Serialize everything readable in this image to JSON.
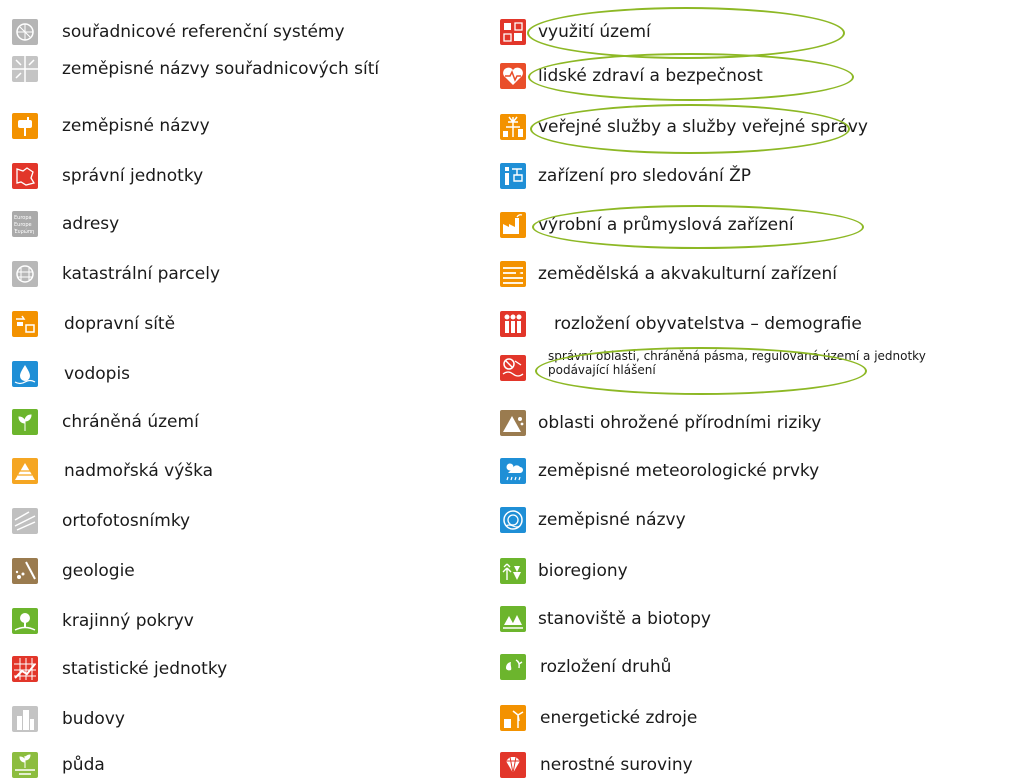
{
  "left_column": [
    {
      "label": "souřadnicové referenční systémy",
      "icon": "globe-grid-icon",
      "color": "#b5b5b5"
    },
    {
      "label": "zeměpisné názvy souřadnicových sítí",
      "icon": "grid-arrows-icon",
      "color": "#c4c4c4"
    },
    {
      "label": "zeměpisné názvy",
      "icon": "mailbox-icon",
      "color": "#f39200"
    },
    {
      "label": "správní jednotky",
      "icon": "map-regions-icon",
      "color": "#e2362a"
    },
    {
      "label": "adresy",
      "icon": "address-text-icon",
      "color": "#aaaaaa",
      "icon_text": [
        "Europa",
        "Europe",
        "Έυρώπη"
      ]
    },
    {
      "label": "katastrální parcely",
      "icon": "parcel-globe-icon",
      "color": "#b8b8b8"
    },
    {
      "label": "dopravní sítě",
      "icon": "transport-icon",
      "color": "#f39200"
    },
    {
      "label": "vodopis",
      "icon": "water-drop-icon",
      "color": "#1f8fd6"
    },
    {
      "label": "chráněná území",
      "icon": "sprout-icon",
      "color": "#6cb52d"
    },
    {
      "label": "nadmořská výška",
      "icon": "elevation-icon",
      "color": "#f5a623"
    },
    {
      "label": "ortofotosnímky",
      "icon": "orthophoto-icon",
      "color": "#c0c0c0"
    },
    {
      "label": "geologie",
      "icon": "rocks-icon",
      "color": "#9a7b4f"
    },
    {
      "label": "krajinný pokryv",
      "icon": "tree-icon",
      "color": "#6cb52d"
    },
    {
      "label": "statistické jednotky",
      "icon": "statistics-grid-icon",
      "color": "#e2362a"
    },
    {
      "label": "budovy",
      "icon": "buildings-icon",
      "color": "#c4c4c4"
    },
    {
      "label": "půda",
      "icon": "soil-plant-icon",
      "color": "#8cbd3f"
    }
  ],
  "right_column": [
    {
      "label": "využití území",
      "icon": "land-use-icon",
      "color": "#e2362a",
      "circled": true
    },
    {
      "label": "lidské zdraví a bezpečnost",
      "icon": "heart-pulse-icon",
      "color": "#e94e2a",
      "circled": true
    },
    {
      "label": "veřejné služby a služby veřejné správy",
      "icon": "utilities-icon",
      "color": "#f39200",
      "circled": true
    },
    {
      "label": "zařízení pro sledování ŽP",
      "icon": "monitoring-icon",
      "color": "#1f8fd6",
      "circled": false
    },
    {
      "label": "výrobní a průmyslová zařízení",
      "icon": "factory-icon",
      "color": "#f39200",
      "circled": true
    },
    {
      "label": "zemědělská a akvakulturní zařízení",
      "icon": "agriculture-icon",
      "color": "#f39200",
      "circled": false
    },
    {
      "label": "rozložení obyvatelstva – demografie",
      "icon": "people-icon",
      "color": "#e2362a",
      "circled": false
    },
    {
      "label_lines": [
        "správní oblasti, chráněná pásma, regulovaná území a jednotky",
        "podávající hlášení"
      ],
      "icon": "restriction-icon",
      "color": "#e2362a",
      "circled": true
    },
    {
      "label": "oblasti ohrožené přírodními riziky",
      "icon": "hazard-icon",
      "color": "#9a7b4f",
      "circled": false
    },
    {
      "label": "zeměpisné meteorologické prvky",
      "icon": "weather-icon",
      "color": "#1f8fd6",
      "circled": false
    },
    {
      "label": "zeměpisné názvy",
      "icon": "ocean-wave-icon",
      "color": "#1f8fd6",
      "circled": false
    },
    {
      "label": "bioregiony",
      "icon": "bioregion-icon",
      "color": "#6cb52d",
      "circled": false
    },
    {
      "label": "stanoviště a biotopy",
      "icon": "habitat-icon",
      "color": "#6cb52d",
      "circled": false
    },
    {
      "label": "rozložení druhů",
      "icon": "species-icon",
      "color": "#6cb52d",
      "circled": false
    },
    {
      "label": "energetické zdroje",
      "icon": "energy-icon",
      "color": "#f39200",
      "circled": false
    },
    {
      "label": "nerostné suroviny",
      "icon": "mineral-icon",
      "color": "#e2362a",
      "circled": false
    }
  ],
  "highlight_color": "#8db825"
}
